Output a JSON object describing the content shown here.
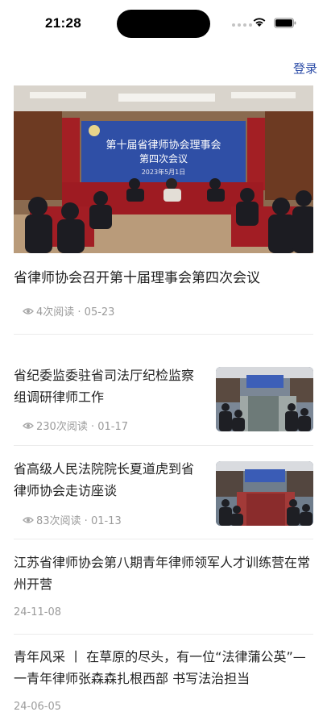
{
  "status_bar": {
    "time": "21:28"
  },
  "header": {
    "login_label": "登录"
  },
  "featured": {
    "title": "省律师协会召开第十届理事会第四次会议",
    "meta": "4次阅读 · 05-23",
    "image": {
      "banner_title": "第十届省律师协会理事会",
      "banner_subtitle": "第四次会议",
      "banner_date": "2023年5月1日"
    }
  },
  "news": [
    {
      "title": "省纪委监委驻省司法厅纪检监察组调研律师工作",
      "meta": "230次阅读 · 01-17"
    },
    {
      "title": "省高级人民法院院长夏道虎到省律师协会走访座谈",
      "meta": "83次阅读 · 01-13"
    },
    {
      "title": "江苏省律师协会第八期青年律师领军人才训练营在常州开营",
      "date": "24-11-08"
    },
    {
      "title": "青年风采 丨 在草原的尽头，有一位“法律蒲公英”—一青年律师张森森扎根西部 书写法治担当",
      "date": "24-06-05"
    }
  ],
  "icons": {
    "views": "eye-icon",
    "wifi": "wifi-icon",
    "battery": "battery-icon"
  },
  "colors": {
    "accent": "#2e4ea8",
    "meta_text": "#9b9b9b",
    "banner_blue": "#2f4fa6",
    "banner_red": "#8f1d22"
  }
}
